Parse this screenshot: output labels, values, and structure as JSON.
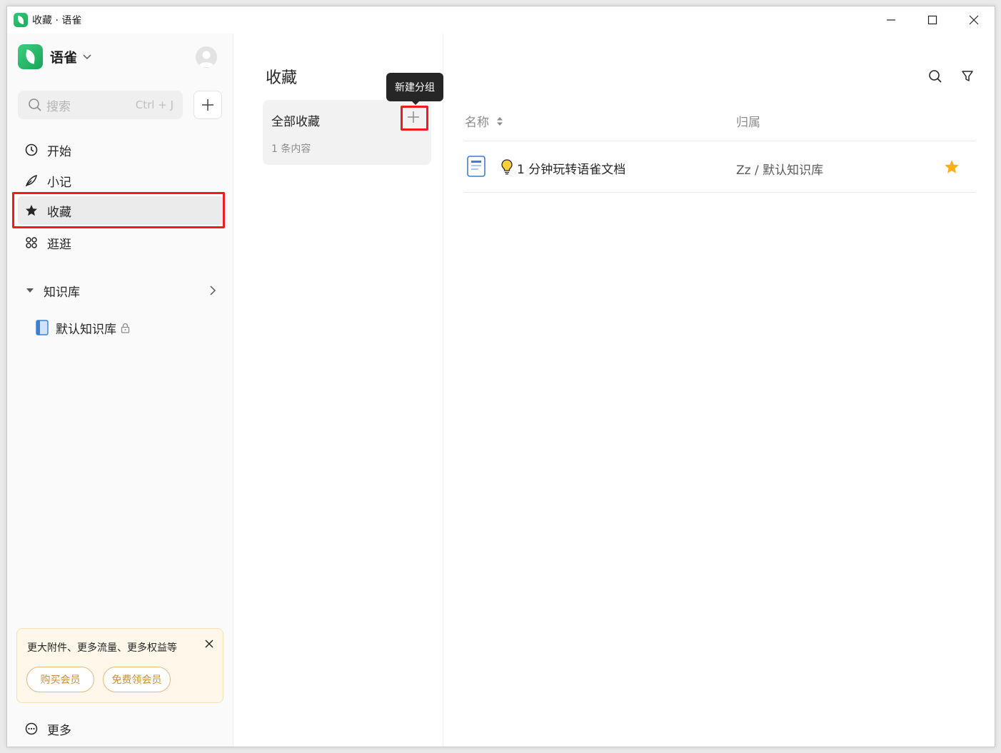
{
  "window": {
    "title": "收藏 · 语雀"
  },
  "sidebar": {
    "brand": "语雀",
    "search": {
      "placeholder": "搜索",
      "shortcut": "Ctrl + J"
    },
    "nav": [
      {
        "label": "开始",
        "icon": "clock-icon"
      },
      {
        "label": "小记",
        "icon": "feather-icon"
      },
      {
        "label": "收藏",
        "icon": "star-icon",
        "active": true
      },
      {
        "label": "逛逛",
        "icon": "apps-icon"
      }
    ],
    "knowledge_base": {
      "label": "知识库",
      "items": [
        {
          "label": "默认知识库",
          "locked": true
        }
      ]
    },
    "promo": {
      "text": "更大附件、更多流量、更多权益等",
      "buy_label": "购买会员",
      "free_label": "免费领会员"
    },
    "more_label": "更多"
  },
  "groups": {
    "page_title": "收藏",
    "card": {
      "name": "全部收藏",
      "count": "1 条内容"
    },
    "tooltip": "新建分组"
  },
  "list": {
    "columns": {
      "name": "名称",
      "owner": "归属"
    },
    "rows": [
      {
        "title": "1 分钟玩转语雀文档",
        "owner": "Zz / 默认知识库",
        "starred": true
      }
    ]
  },
  "colors": {
    "accent_green": "#1aad5b",
    "highlight_red": "#ee1c1c",
    "star_gold": "#fbb01a",
    "promo_orange": "#c68f3c"
  }
}
